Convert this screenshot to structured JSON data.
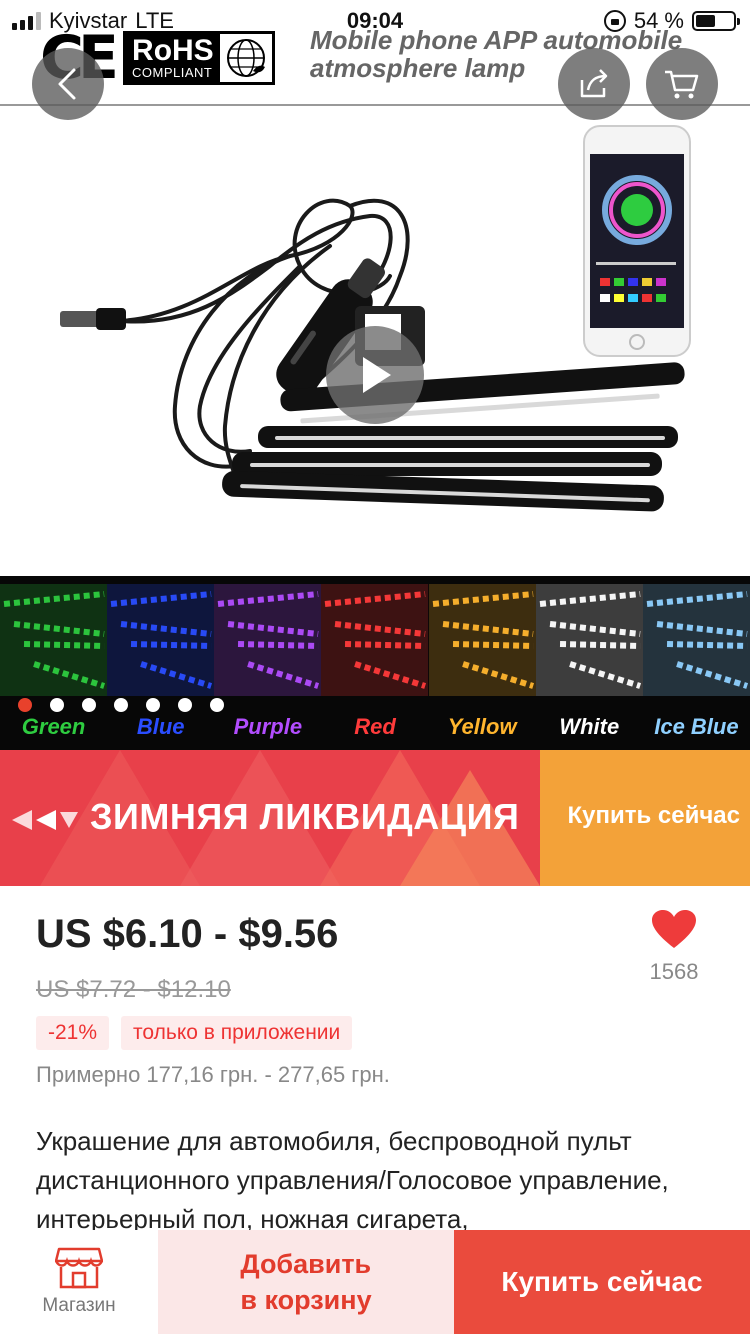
{
  "status_bar": {
    "carrier": "Kyivstar",
    "network": "LTE",
    "time": "09:04",
    "battery": "54 %",
    "battery_level": 0.54
  },
  "hero": {
    "cert_ce": "CE",
    "cert_rohs": "RoHS",
    "cert_rohs_sub": "COMPLIANT",
    "headline_line1": "Mobile phone APP automobile",
    "headline_line2": "atmosphere lamp",
    "icons": {
      "back": "chevron-left-icon",
      "share": "share-icon",
      "cart": "cart-icon",
      "play": "play-icon"
    },
    "gallery_count": 7,
    "gallery_active": 0,
    "colors": [
      {
        "label": "Green",
        "color": "#2ecc40"
      },
      {
        "label": "Blue",
        "color": "#2a4dff"
      },
      {
        "label": "Purple",
        "color": "#b24dff"
      },
      {
        "label": "Red",
        "color": "#ff3b3b"
      },
      {
        "label": "Yellow",
        "color": "#ffb52e"
      },
      {
        "label": "White",
        "color": "#ffffff"
      },
      {
        "label": "Ice Blue",
        "color": "#8fd0ff"
      }
    ]
  },
  "banner": {
    "title": "ЗИМНЯЯ ЛИКВИДАЦИЯ",
    "cta": "Купить сейчас",
    "color_main": "#e8404a",
    "color_cta": "#f3a239"
  },
  "product": {
    "price": "US $6.10 - $9.56",
    "old_price": "US $7.72 - $12.10",
    "discount": "-21%",
    "app_only": "только в приложении",
    "approx_price": "Примерно 177,16 грн. - 277,65 грн.",
    "wishlist_count": "1568",
    "description": "Украшение для автомобиля, беспроводной пульт дистанционного управления/Голосовое управление, интерьерный пол, ножная сигарета,"
  },
  "bottom_bar": {
    "store_label": "Магазин",
    "add_to_cart_line1": "Добавить",
    "add_to_cart_line2": "в корзину",
    "buy_now": "Купить сейчас",
    "accent": "#ea4b3d"
  }
}
